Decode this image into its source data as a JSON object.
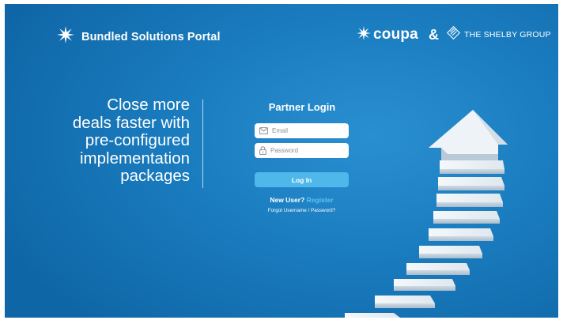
{
  "header": {
    "brand_title": "Bundled Solutions Portal",
    "coupa_label": "coupa",
    "ampersand": "&",
    "shelby_label": "THE SHELBY GROUP"
  },
  "tagline": {
    "lines": [
      "Close more",
      "deals faster with",
      "pre-configured",
      "implementation",
      "packages"
    ]
  },
  "login": {
    "title": "Partner Login",
    "email_placeholder": "Email",
    "password_placeholder": "Password",
    "login_label": "Log In",
    "new_user_text": "New User?",
    "register_label": "Register",
    "forgot_label": "Forgot Username / Password?"
  },
  "colors": {
    "background": "#1a7dc0",
    "login_button": "#4fb8ea",
    "register_link": "#5ec4f2"
  },
  "icons": {
    "brand": "starburst-logo-icon",
    "coupa": "coupa-star-icon",
    "shelby": "shelby-group-logo-icon",
    "email": "envelope-icon",
    "password": "lock-icon"
  }
}
